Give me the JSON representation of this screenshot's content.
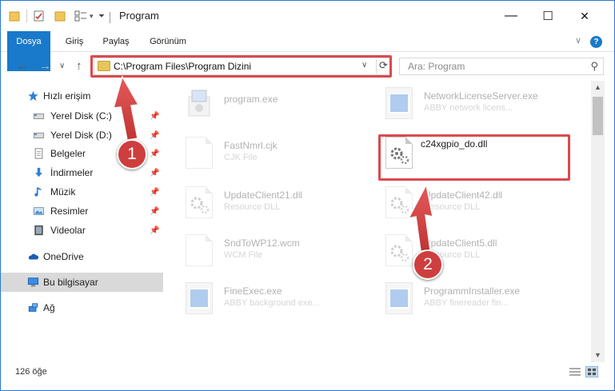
{
  "window": {
    "title": "Program",
    "controls": {
      "minimize": "—",
      "maximize": "☐",
      "close": "✕"
    }
  },
  "ribbon": {
    "tabs": [
      "Dosya",
      "Giriş",
      "Paylaş",
      "Görünüm"
    ],
    "help": "?",
    "expand": "∨"
  },
  "nav": {
    "back": "←",
    "forward": "→",
    "recent": "∨",
    "up": "↑",
    "address": "C:\\Program Files\\Program Dizini",
    "search_placeholder": "Ara: Program"
  },
  "sidebar": {
    "items": [
      {
        "label": "Hızlı erişim",
        "icon": "star-icon",
        "pinned": false
      },
      {
        "label": "Yerel Disk (C:)",
        "icon": "drive-icon",
        "pinned": true
      },
      {
        "label": "Yerel Disk (D:)",
        "icon": "drive-icon",
        "pinned": true
      },
      {
        "label": "Belgeler",
        "icon": "documents-icon",
        "pinned": true
      },
      {
        "label": "İndirmeler",
        "icon": "download-icon",
        "pinned": true
      },
      {
        "label": "Müzik",
        "icon": "music-icon",
        "pinned": true
      },
      {
        "label": "Resimler",
        "icon": "pictures-icon",
        "pinned": true
      },
      {
        "label": "Videolar",
        "icon": "video-icon",
        "pinned": true
      },
      {
        "label": "OneDrive",
        "icon": "cloud-icon",
        "pinned": false
      },
      {
        "label": "Bu bilgisayar",
        "icon": "computer-icon",
        "pinned": false,
        "selected": true
      },
      {
        "label": "Ağ",
        "icon": "network-icon",
        "pinned": false
      }
    ]
  },
  "files": [
    {
      "name": "program.exe",
      "type": "",
      "kind": "installer",
      "faded": true
    },
    {
      "name": "NetworkLicenseServer.exe",
      "type": "ABBY network licens...",
      "kind": "exe",
      "faded": true
    },
    {
      "name": "FastNmrl.cjk",
      "type": "CJK File",
      "kind": "doc",
      "faded": true
    },
    {
      "name": "c24xgpio_do.dll",
      "type": "",
      "kind": "dll",
      "faded": false
    },
    {
      "name": "UpdateClient21.dll",
      "type": "Resource DLL",
      "kind": "dll",
      "faded": true
    },
    {
      "name": "UpdateClient42.dll",
      "type": "Resource DLL",
      "kind": "dll",
      "faded": true
    },
    {
      "name": "SndToWP12.wcm",
      "type": "WCM File",
      "kind": "doc",
      "faded": true
    },
    {
      "name": "UpdateClient5.dll",
      "type": "Resource DLL",
      "kind": "dll",
      "faded": true
    },
    {
      "name": "FineExec.exe",
      "type": "ABBY background exe...",
      "kind": "exe",
      "faded": true
    },
    {
      "name": "ProgrammInstaller.exe",
      "type": "ABBY finereader fin...",
      "kind": "exe",
      "faded": true
    }
  ],
  "status": {
    "count": "126 öğe"
  },
  "annotations": {
    "step1": "1",
    "step2": "2",
    "highlight_color": "#d94a4f"
  }
}
